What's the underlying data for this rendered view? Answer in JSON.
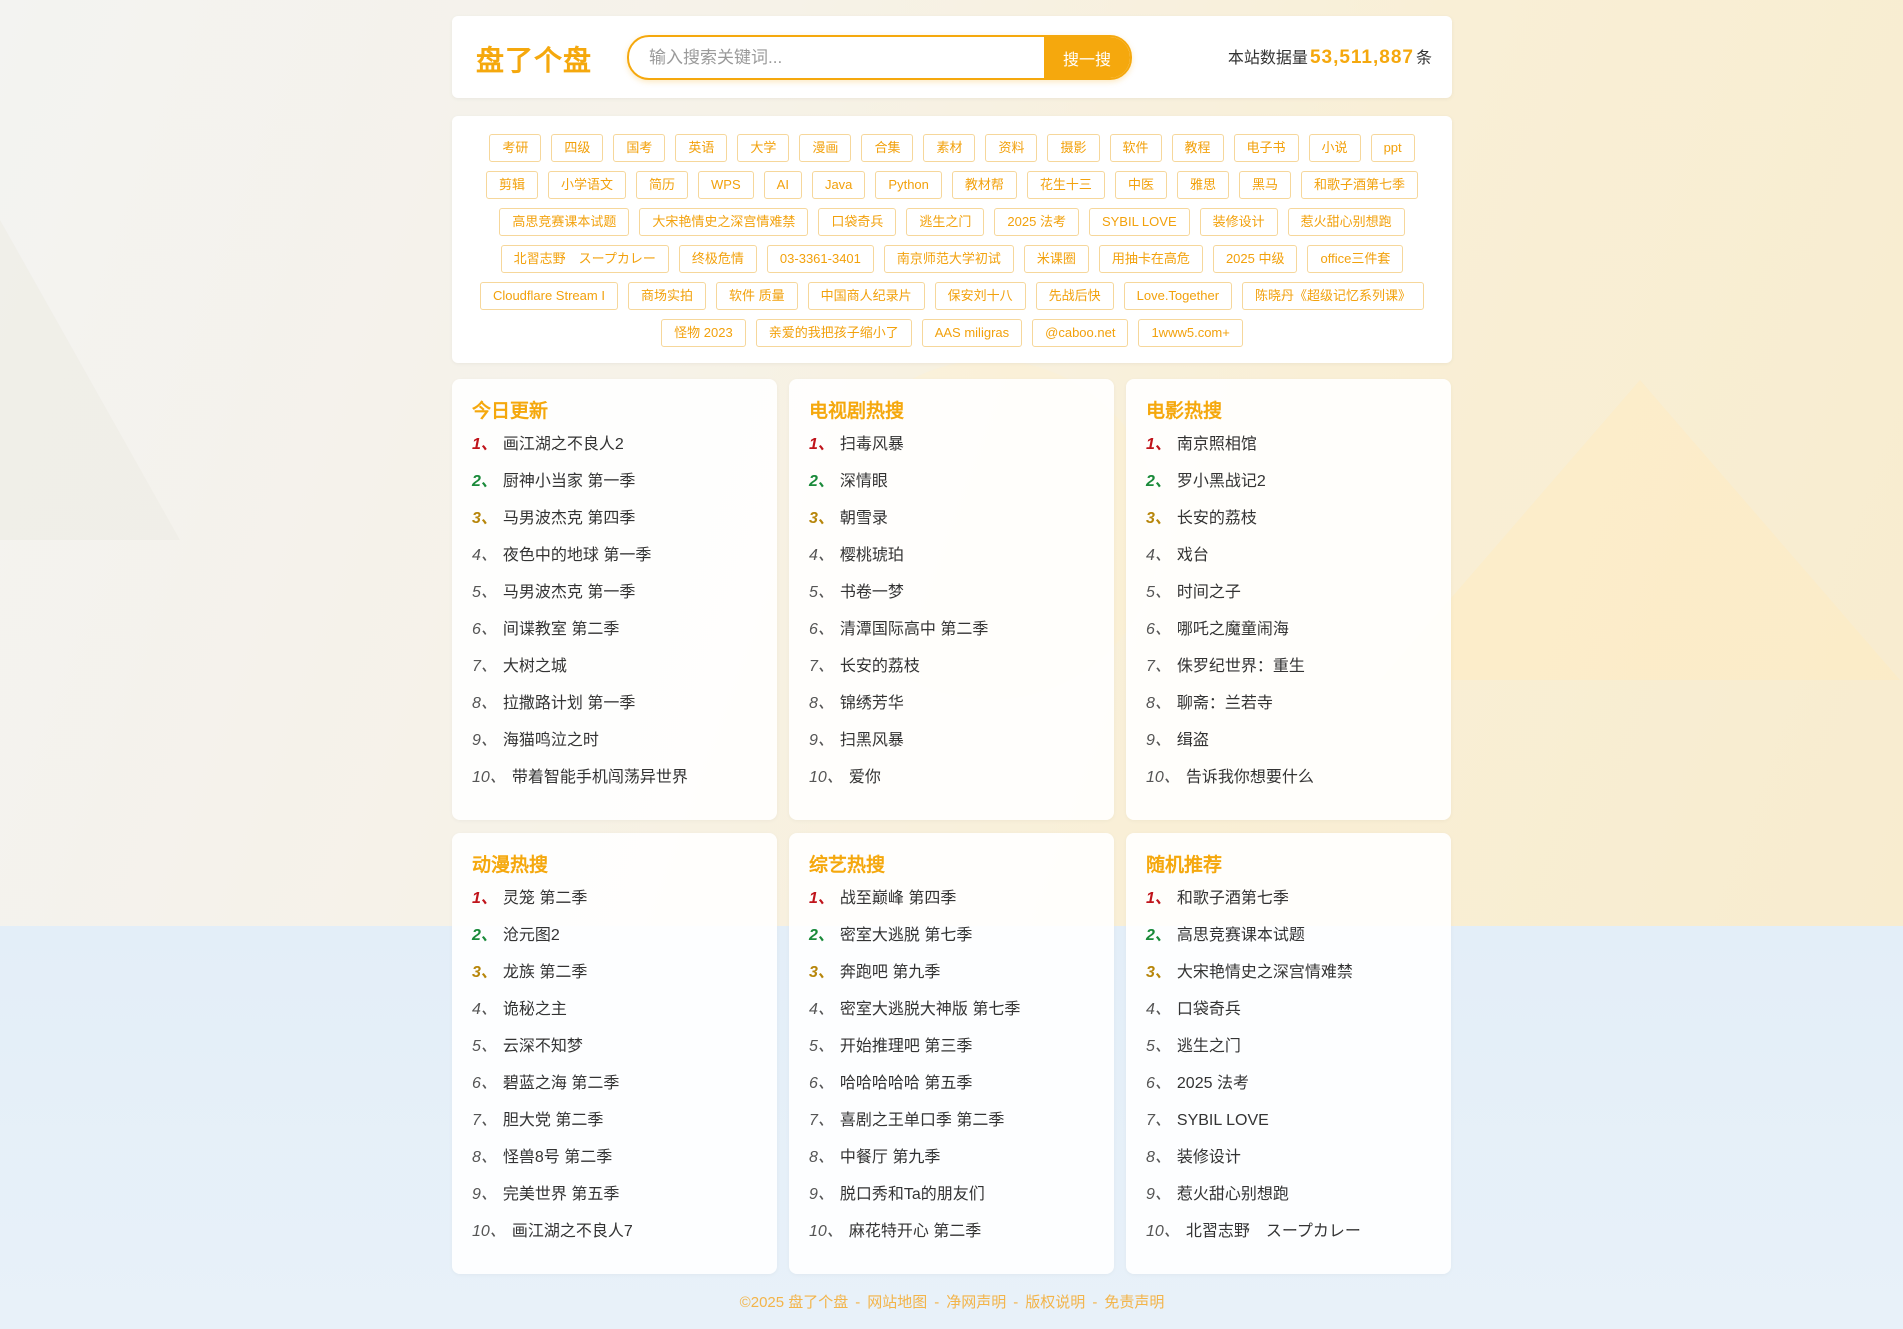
{
  "header": {
    "logo": "盘了个盘",
    "search_placeholder": "输入搜索关键词...",
    "search_button": "搜一搜",
    "stat_prefix": "本站数据量",
    "stat_value": "53,511,887",
    "stat_suffix": "条"
  },
  "tags": [
    "考研",
    "四级",
    "国考",
    "英语",
    "大学",
    "漫画",
    "合集",
    "素材",
    "资料",
    "摄影",
    "软件",
    "教程",
    "电子书",
    "小说",
    "ppt",
    "剪辑",
    "小学语文",
    "简历",
    "WPS",
    "AI",
    "Java",
    "Python",
    "教材帮",
    "花生十三",
    "中医",
    "雅思",
    "黑马",
    "和歌子酒第七季",
    "高思竞赛课本试题",
    "大宋艳情史之深宫情难禁",
    "口袋奇兵",
    "逃生之门",
    "2025 法考",
    "SYBIL LOVE",
    "装修设计",
    "惹火甜心别想跑",
    "北習志野　スープカレー",
    "终极危情",
    "03-3361-3401",
    "南京师范大学初试",
    "米课圈",
    "用抽卡在高危",
    "2025 中级",
    "office三件套",
    "Cloudflare Stream I",
    "商场实拍",
    "软件 质量",
    "中国商人纪录片",
    "保安刘十八",
    "先战后快",
    "Love.Together",
    "陈晓丹《超级记忆系列课》",
    "怪物 2023",
    "亲爱的我把孩子缩小了",
    "AAS miligras",
    "@caboo.net",
    "1www5.com+"
  ],
  "panels": [
    {
      "title": "今日更新",
      "items": [
        "画江湖之不良人2",
        "厨神小当家 第一季",
        "马男波杰克 第四季",
        "夜色中的地球 第一季",
        "马男波杰克 第一季",
        "间谍教室 第二季",
        "大树之城",
        "拉撒路计划 第一季",
        "海猫鸣泣之时",
        "带着智能手机闯荡异世界"
      ]
    },
    {
      "title": "电视剧热搜",
      "items": [
        "扫毒风暴",
        "深情眼",
        "朝雪录",
        "樱桃琥珀",
        "书卷一梦",
        "清潭国际高中 第二季",
        "长安的荔枝",
        "锦绣芳华",
        "扫黑风暴",
        "爱你"
      ]
    },
    {
      "title": "电影热搜",
      "items": [
        "南京照相馆",
        "罗小黑战记2",
        "长安的荔枝",
        "戏台",
        "时间之子",
        "哪吒之魔童闹海",
        "侏罗纪世界：重生",
        "聊斋：兰若寺",
        "缉盗",
        "告诉我你想要什么"
      ]
    },
    {
      "title": "动漫热搜",
      "items": [
        "灵笼 第二季",
        "沧元图2",
        "龙族 第二季",
        "诡秘之主",
        "云深不知梦",
        "碧蓝之海 第二季",
        "胆大党 第二季",
        "怪兽8号 第二季",
        "完美世界 第五季",
        "画江湖之不良人7"
      ]
    },
    {
      "title": "综艺热搜",
      "items": [
        "战至巅峰 第四季",
        "密室大逃脱 第七季",
        "奔跑吧 第九季",
        "密室大逃脱大神版 第七季",
        "开始推理吧 第三季",
        "哈哈哈哈哈 第五季",
        "喜剧之王单口季 第二季",
        "中餐厅 第九季",
        "脱口秀和Ta的朋友们",
        "麻花特开心 第二季"
      ]
    },
    {
      "title": "随机推荐",
      "items": [
        "和歌子酒第七季",
        "高思竞赛课本试题",
        "大宋艳情史之深宫情难禁",
        "口袋奇兵",
        "逃生之门",
        "2025 法考",
        "SYBIL LOVE",
        "装修设计",
        "惹火甜心别想跑",
        "北習志野　スープカレー"
      ]
    }
  ],
  "footer": {
    "copyright": "©2025 盘了个盘",
    "links": [
      "网站地图",
      "净网声明",
      "版权说明",
      "免责声明"
    ],
    "separator": "-"
  },
  "colors": {
    "accent": "#f5a80d",
    "rank1": "#c0141b",
    "rank2": "#1a8a3a",
    "rank3": "#b7860b"
  }
}
